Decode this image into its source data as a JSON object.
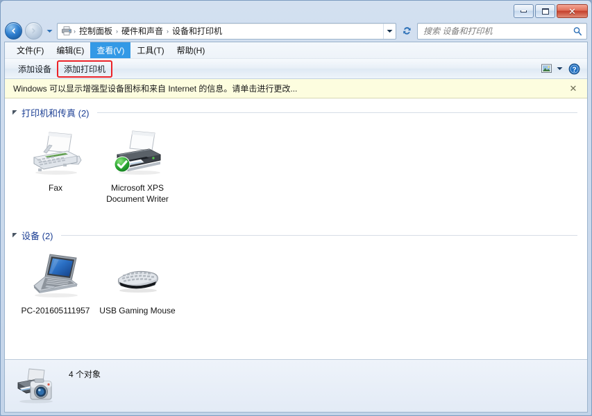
{
  "window": {
    "controls": {
      "minimize_label": "–",
      "maximize_label": "□",
      "close_label": "✕"
    }
  },
  "nav": {
    "back_tooltip": "后退",
    "forward_tooltip": "前进",
    "history_tooltip": "最近浏览的位置",
    "refresh_tooltip": "刷新",
    "breadcrumbs": [
      {
        "label": "控制面板"
      },
      {
        "label": "硬件和声音"
      },
      {
        "label": "设备和打印机"
      }
    ],
    "separator": "›"
  },
  "search": {
    "placeholder": "搜索 设备和打印机",
    "value": "",
    "icon": "search-icon"
  },
  "menubar": {
    "items": [
      {
        "label": "文件(F)",
        "active": false
      },
      {
        "label": "编辑(E)",
        "active": false
      },
      {
        "label": "查看(V)",
        "active": true
      },
      {
        "label": "工具(T)",
        "active": false
      },
      {
        "label": "帮助(H)",
        "active": false
      }
    ]
  },
  "toolbar": {
    "add_device_label": "添加设备",
    "add_printer_label": "添加打印机",
    "add_printer_highlighted": true,
    "view_icon": "view-options-icon",
    "view_caret": "chevron-down-icon",
    "help_icon": "help-icon"
  },
  "notification": {
    "message": "Windows 可以显示增强型设备图标和来自 Internet 的信息。请单击进行更改...",
    "close_label": "✕"
  },
  "groups": [
    {
      "title": "打印机和传真 (2)",
      "expanded": true,
      "items": [
        {
          "label": "Fax",
          "icon": "fax-icon",
          "default_badge": false
        },
        {
          "label": "Microsoft XPS Document Writer",
          "icon": "printer-icon",
          "default_badge": true
        }
      ]
    },
    {
      "title": "设备 (2)",
      "expanded": true,
      "items": [
        {
          "label": "PC-201605111957",
          "icon": "laptop-icon",
          "default_badge": false
        },
        {
          "label": "USB Gaming Mouse",
          "icon": "mouse-icon",
          "default_badge": false
        }
      ]
    }
  ],
  "statusbar": {
    "text": "4 个对象",
    "icon": "devices-printer-camera-icon"
  },
  "colors": {
    "accent": "#1c3f94",
    "menu_active": "#3399e6",
    "highlight_outline": "#ec2227",
    "notification_bg": "#fdfddf",
    "frame": "#c3d4e9"
  }
}
